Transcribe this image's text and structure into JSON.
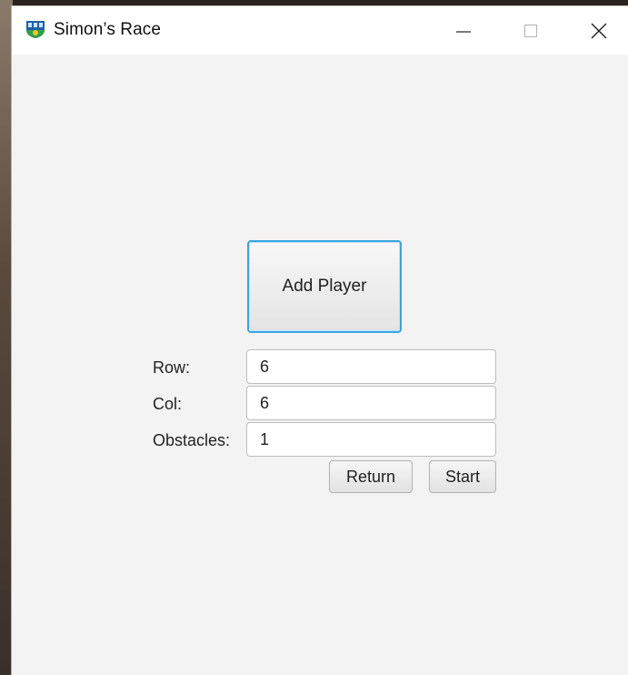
{
  "window": {
    "title": "Simon’s Race",
    "icon": "app-shield-icon"
  },
  "titlebar_controls": {
    "minimize_icon": "minimize-icon",
    "maximize_icon": "maximize-icon",
    "close_icon": "close-icon"
  },
  "main": {
    "add_player_label": "Add Player",
    "fields": {
      "row_label": "Row:",
      "row_value": "6",
      "col_label": "Col:",
      "col_value": "6",
      "obstacles_label": "Obstacles:",
      "obstacles_value": "1"
    },
    "buttons": {
      "return_label": "Return",
      "start_label": "Start"
    }
  },
  "colors": {
    "focus_border": "#3aa6e0",
    "background": "#f3f3f3"
  }
}
